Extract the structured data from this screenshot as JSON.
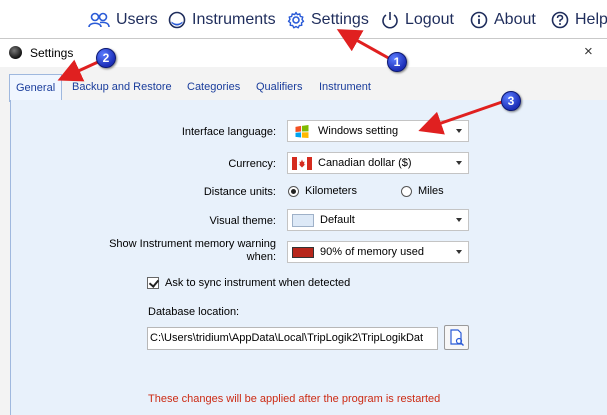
{
  "nav": {
    "users_label": "Users",
    "instruments_label": "Instruments",
    "settings_label": "Settings",
    "logout_label": "Logout",
    "about_label": "About",
    "help_label": "Help"
  },
  "dialog": {
    "title": "Settings",
    "close_glyph": "×",
    "tabs": [
      {
        "label": "General",
        "active": true
      },
      {
        "label": "Backup and Restore",
        "active": false
      },
      {
        "label": "Categories",
        "active": false
      },
      {
        "label": "Qualifiers",
        "active": false
      },
      {
        "label": "Instrument",
        "active": false
      }
    ]
  },
  "general": {
    "interface_language": {
      "label": "Interface language:",
      "value": "Windows setting"
    },
    "currency": {
      "label": "Currency:",
      "value": "Canadian dollar ($)"
    },
    "distance_units": {
      "label": "Distance units:",
      "options": [
        {
          "label": "Kilometers",
          "selected": true
        },
        {
          "label": "Miles",
          "selected": false
        }
      ]
    },
    "visual_theme": {
      "label": "Visual theme:",
      "value": "Default"
    },
    "memory_warning": {
      "label_line1": "Show Instrument memory warning",
      "label_line2": "when:",
      "value": "90% of memory used"
    },
    "sync_checkbox": {
      "label": "Ask to sync instrument when detected",
      "checked": true
    },
    "database_location": {
      "label": "Database location:",
      "value": "C:\\Users\\tridium\\AppData\\Local\\TripLogik2\\TripLogikDat"
    },
    "restart_note": "These changes will be applied after the program is restarted"
  },
  "callouts": [
    "1",
    "2",
    "3"
  ],
  "colors": {
    "nav_text": "#1f2d5c",
    "tab_text": "#1a3d9c",
    "panel_bg": "#e8f1fb",
    "warning_text": "#cc2b14",
    "callout_blue": "#1d2fb8",
    "arrow_red": "#e02020"
  }
}
